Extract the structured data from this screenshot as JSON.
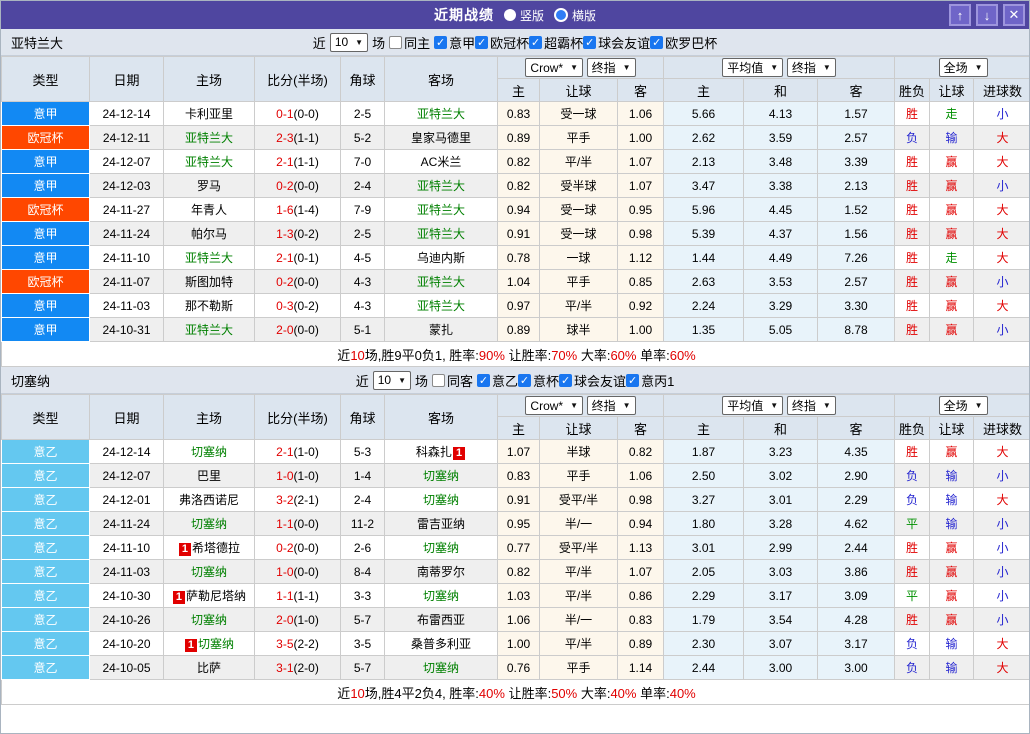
{
  "titlebar": {
    "title": "近期战绩",
    "radio_vertical": "竖版",
    "radio_horizontal": "横版",
    "buttons": {
      "up": "↑",
      "down": "↓",
      "close": "✕"
    }
  },
  "table_header": {
    "type": "类型",
    "date": "日期",
    "home": "主场",
    "score": "比分(半场)",
    "corner": "角球",
    "away": "客场",
    "selects": {
      "source": "Crow*",
      "time1": "终指",
      "avg": "平均值",
      "time2": "终指",
      "scope": "全场"
    },
    "sub": {
      "o_home": "主",
      "o_handicap": "让球",
      "o_away": "客",
      "a_home": "主",
      "a_draw": "和",
      "a_away": "客",
      "result": "胜负",
      "h_result": "让球",
      "goals": "进球数"
    }
  },
  "sections": [
    {
      "team": "亚特兰大",
      "filter": {
        "near_label": "近",
        "games": "10",
        "games_suffix": "场",
        "same_label": "同主",
        "leagues": [
          "意甲",
          "欧冠杯",
          "超霸杯",
          "球会友谊",
          "欧罗巴杯"
        ]
      },
      "rows": [
        {
          "lg": "意甲",
          "lc": "a",
          "date": "24-12-14",
          "home": "卡利亚里",
          "hg": 0,
          "hc": "",
          "score": "0-1",
          "half": "(0-0)",
          "corner": "2-5",
          "away": "亚特兰大",
          "ag": 1,
          "ac": "",
          "o1": "0.83",
          "hd": "受一球",
          "o2": "1.06",
          "a1": "5.66",
          "a2": "4.13",
          "a3": "1.57",
          "res": "胜",
          "resc": "r",
          "hres": "走",
          "hresc": "g",
          "gl": "小",
          "glc": "b"
        },
        {
          "lg": "欧冠杯",
          "lc": "c",
          "date": "24-12-11",
          "home": "亚特兰大",
          "hg": 1,
          "hc": "",
          "score": "2-3",
          "half": "(1-1)",
          "corner": "5-2",
          "away": "皇家马德里",
          "ag": 0,
          "ac": "",
          "o1": "0.89",
          "hd": "平手",
          "o2": "1.00",
          "a1": "2.62",
          "a2": "3.59",
          "a3": "2.57",
          "res": "负",
          "resc": "b",
          "hres": "输",
          "hresc": "b",
          "gl": "大",
          "glc": "r"
        },
        {
          "lg": "意甲",
          "lc": "a",
          "date": "24-12-07",
          "home": "亚特兰大",
          "hg": 1,
          "hc": "",
          "score": "2-1",
          "half": "(1-1)",
          "corner": "7-0",
          "away": "AC米兰",
          "ag": 0,
          "ac": "",
          "o1": "0.82",
          "hd": "平/半",
          "o2": "1.07",
          "a1": "2.13",
          "a2": "3.48",
          "a3": "3.39",
          "res": "胜",
          "resc": "r",
          "hres": "赢",
          "hresc": "r",
          "gl": "大",
          "glc": "r"
        },
        {
          "lg": "意甲",
          "lc": "a",
          "date": "24-12-03",
          "home": "罗马",
          "hg": 0,
          "hc": "",
          "score": "0-2",
          "half": "(0-0)",
          "corner": "2-4",
          "away": "亚特兰大",
          "ag": 1,
          "ac": "",
          "o1": "0.82",
          "hd": "受半球",
          "o2": "1.07",
          "a1": "3.47",
          "a2": "3.38",
          "a3": "2.13",
          "res": "胜",
          "resc": "r",
          "hres": "赢",
          "hresc": "r",
          "gl": "小",
          "glc": "b"
        },
        {
          "lg": "欧冠杯",
          "lc": "c",
          "date": "24-11-27",
          "home": "年青人",
          "hg": 0,
          "hc": "",
          "score": "1-6",
          "half": "(1-4)",
          "corner": "7-9",
          "away": "亚特兰大",
          "ag": 1,
          "ac": "",
          "o1": "0.94",
          "hd": "受一球",
          "o2": "0.95",
          "a1": "5.96",
          "a2": "4.45",
          "a3": "1.52",
          "res": "胜",
          "resc": "r",
          "hres": "赢",
          "hresc": "r",
          "gl": "大",
          "glc": "r"
        },
        {
          "lg": "意甲",
          "lc": "a",
          "date": "24-11-24",
          "home": "帕尔马",
          "hg": 0,
          "hc": "",
          "score": "1-3",
          "half": "(0-2)",
          "corner": "2-5",
          "away": "亚特兰大",
          "ag": 1,
          "ac": "",
          "o1": "0.91",
          "hd": "受一球",
          "o2": "0.98",
          "a1": "5.39",
          "a2": "4.37",
          "a3": "1.56",
          "res": "胜",
          "resc": "r",
          "hres": "赢",
          "hresc": "r",
          "gl": "大",
          "glc": "r"
        },
        {
          "lg": "意甲",
          "lc": "a",
          "date": "24-11-10",
          "home": "亚特兰大",
          "hg": 1,
          "hc": "",
          "score": "2-1",
          "half": "(0-1)",
          "corner": "4-5",
          "away": "乌迪内斯",
          "ag": 0,
          "ac": "",
          "o1": "0.78",
          "hd": "一球",
          "o2": "1.12",
          "a1": "1.44",
          "a2": "4.49",
          "a3": "7.26",
          "res": "胜",
          "resc": "r",
          "hres": "走",
          "hresc": "g",
          "gl": "大",
          "glc": "r"
        },
        {
          "lg": "欧冠杯",
          "lc": "c",
          "date": "24-11-07",
          "home": "斯图加特",
          "hg": 0,
          "hc": "",
          "score": "0-2",
          "half": "(0-0)",
          "corner": "4-3",
          "away": "亚特兰大",
          "ag": 1,
          "ac": "",
          "o1": "1.04",
          "hd": "平手",
          "o2": "0.85",
          "a1": "2.63",
          "a2": "3.53",
          "a3": "2.57",
          "res": "胜",
          "resc": "r",
          "hres": "赢",
          "hresc": "r",
          "gl": "小",
          "glc": "b"
        },
        {
          "lg": "意甲",
          "lc": "a",
          "date": "24-11-03",
          "home": "那不勒斯",
          "hg": 0,
          "hc": "",
          "score": "0-3",
          "half": "(0-2)",
          "corner": "4-3",
          "away": "亚特兰大",
          "ag": 1,
          "ac": "",
          "o1": "0.97",
          "hd": "平/半",
          "o2": "0.92",
          "a1": "2.24",
          "a2": "3.29",
          "a3": "3.30",
          "res": "胜",
          "resc": "r",
          "hres": "赢",
          "hresc": "r",
          "gl": "大",
          "glc": "r"
        },
        {
          "lg": "意甲",
          "lc": "a",
          "date": "24-10-31",
          "home": "亚特兰大",
          "hg": 1,
          "hc": "",
          "score": "2-0",
          "half": "(0-0)",
          "corner": "5-1",
          "away": "蒙扎",
          "ag": 0,
          "ac": "",
          "o1": "0.89",
          "hd": "球半",
          "o2": "1.00",
          "a1": "1.35",
          "a2": "5.05",
          "a3": "8.78",
          "res": "胜",
          "resc": "r",
          "hres": "赢",
          "hresc": "r",
          "gl": "小",
          "glc": "b"
        }
      ],
      "summary": [
        {
          "t": "近"
        },
        {
          "t": "10",
          "red": 1
        },
        {
          "t": "场,胜9平0负1, 胜率:"
        },
        {
          "t": "90%",
          "red": 1
        },
        {
          "t": " 让胜率:"
        },
        {
          "t": "70%",
          "red": 1
        },
        {
          "t": " 大率:"
        },
        {
          "t": "60%",
          "red": 1
        },
        {
          "t": " 单率:"
        },
        {
          "t": "60%",
          "red": 1
        }
      ]
    },
    {
      "team": "切塞纳",
      "filter": {
        "near_label": "近",
        "games": "10",
        "games_suffix": "场",
        "same_label": "同客",
        "leagues": [
          "意乙",
          "意杯",
          "球会友谊",
          "意丙1"
        ]
      },
      "rows": [
        {
          "lg": "意乙",
          "lc": "b",
          "date": "24-12-14",
          "home": "切塞纳",
          "hg": 1,
          "hc": "",
          "score": "2-1",
          "half": "(1-0)",
          "corner": "5-3",
          "away": "科森扎",
          "ag": 0,
          "ac": "1",
          "o1": "1.07",
          "hd": "半球",
          "o2": "0.82",
          "a1": "1.87",
          "a2": "3.23",
          "a3": "4.35",
          "res": "胜",
          "resc": "r",
          "hres": "赢",
          "hresc": "r",
          "gl": "大",
          "glc": "r"
        },
        {
          "lg": "意乙",
          "lc": "b",
          "date": "24-12-07",
          "home": "巴里",
          "hg": 0,
          "hc": "",
          "score": "1-0",
          "half": "(1-0)",
          "corner": "1-4",
          "away": "切塞纳",
          "ag": 1,
          "ac": "",
          "o1": "0.83",
          "hd": "平手",
          "o2": "1.06",
          "a1": "2.50",
          "a2": "3.02",
          "a3": "2.90",
          "res": "负",
          "resc": "b",
          "hres": "输",
          "hresc": "b",
          "gl": "小",
          "glc": "b"
        },
        {
          "lg": "意乙",
          "lc": "b",
          "date": "24-12-01",
          "home": "弗洛西诺尼",
          "hg": 0,
          "hc": "",
          "score": "3-2",
          "half": "(2-1)",
          "corner": "2-4",
          "away": "切塞纳",
          "ag": 1,
          "ac": "",
          "o1": "0.91",
          "hd": "受平/半",
          "o2": "0.98",
          "a1": "3.27",
          "a2": "3.01",
          "a3": "2.29",
          "res": "负",
          "resc": "b",
          "hres": "输",
          "hresc": "b",
          "gl": "大",
          "glc": "r"
        },
        {
          "lg": "意乙",
          "lc": "b",
          "date": "24-11-24",
          "home": "切塞纳",
          "hg": 1,
          "hc": "",
          "score": "1-1",
          "half": "(0-0)",
          "corner": "11-2",
          "away": "雷吉亚纳",
          "ag": 0,
          "ac": "",
          "o1": "0.95",
          "hd": "半/一",
          "o2": "0.94",
          "a1": "1.80",
          "a2": "3.28",
          "a3": "4.62",
          "res": "平",
          "resc": "g",
          "hres": "输",
          "hresc": "b",
          "gl": "小",
          "glc": "b"
        },
        {
          "lg": "意乙",
          "lc": "b",
          "date": "24-11-10",
          "home": "希塔德拉",
          "hg": 0,
          "hc": "1",
          "score": "0-2",
          "half": "(0-0)",
          "corner": "2-6",
          "away": "切塞纳",
          "ag": 1,
          "ac": "",
          "o1": "0.77",
          "hd": "受平/半",
          "o2": "1.13",
          "a1": "3.01",
          "a2": "2.99",
          "a3": "2.44",
          "res": "胜",
          "resc": "r",
          "hres": "赢",
          "hresc": "r",
          "gl": "小",
          "glc": "b"
        },
        {
          "lg": "意乙",
          "lc": "b",
          "date": "24-11-03",
          "home": "切塞纳",
          "hg": 1,
          "hc": "",
          "score": "1-0",
          "half": "(0-0)",
          "corner": "8-4",
          "away": "南蒂罗尔",
          "ag": 0,
          "ac": "",
          "o1": "0.82",
          "hd": "平/半",
          "o2": "1.07",
          "a1": "2.05",
          "a2": "3.03",
          "a3": "3.86",
          "res": "胜",
          "resc": "r",
          "hres": "赢",
          "hresc": "r",
          "gl": "小",
          "glc": "b"
        },
        {
          "lg": "意乙",
          "lc": "b",
          "date": "24-10-30",
          "home": "萨勒尼塔纳",
          "hg": 0,
          "hc": "1",
          "score": "1-1",
          "half": "(1-1)",
          "corner": "3-3",
          "away": "切塞纳",
          "ag": 1,
          "ac": "",
          "o1": "1.03",
          "hd": "平/半",
          "o2": "0.86",
          "a1": "2.29",
          "a2": "3.17",
          "a3": "3.09",
          "res": "平",
          "resc": "g",
          "hres": "赢",
          "hresc": "r",
          "gl": "小",
          "glc": "b"
        },
        {
          "lg": "意乙",
          "lc": "b",
          "date": "24-10-26",
          "home": "切塞纳",
          "hg": 1,
          "hc": "",
          "score": "2-0",
          "half": "(1-0)",
          "corner": "5-7",
          "away": "布雷西亚",
          "ag": 0,
          "ac": "",
          "o1": "1.06",
          "hd": "半/一",
          "o2": "0.83",
          "a1": "1.79",
          "a2": "3.54",
          "a3": "4.28",
          "res": "胜",
          "resc": "r",
          "hres": "赢",
          "hresc": "r",
          "gl": "小",
          "glc": "b"
        },
        {
          "lg": "意乙",
          "lc": "b",
          "date": "24-10-20",
          "home": "切塞纳",
          "hg": 1,
          "hc": "1",
          "score": "3-5",
          "half": "(2-2)",
          "corner": "3-5",
          "away": "桑普多利亚",
          "ag": 0,
          "ac": "",
          "o1": "1.00",
          "hd": "平/半",
          "o2": "0.89",
          "a1": "2.30",
          "a2": "3.07",
          "a3": "3.17",
          "res": "负",
          "resc": "b",
          "hres": "输",
          "hresc": "b",
          "gl": "大",
          "glc": "r"
        },
        {
          "lg": "意乙",
          "lc": "b",
          "date": "24-10-05",
          "home": "比萨",
          "hg": 0,
          "hc": "",
          "score": "3-1",
          "half": "(2-0)",
          "corner": "5-7",
          "away": "切塞纳",
          "ag": 1,
          "ac": "",
          "o1": "0.76",
          "hd": "平手",
          "o2": "1.14",
          "a1": "2.44",
          "a2": "3.00",
          "a3": "3.00",
          "res": "负",
          "resc": "b",
          "hres": "输",
          "hresc": "b",
          "gl": "大",
          "glc": "r"
        }
      ],
      "summary": [
        {
          "t": "近"
        },
        {
          "t": "10",
          "red": 1
        },
        {
          "t": "场,胜4平2负4, 胜率:"
        },
        {
          "t": "40%",
          "red": 1
        },
        {
          "t": " 让胜率:"
        },
        {
          "t": "50%",
          "red": 1
        },
        {
          "t": " 大率:"
        },
        {
          "t": "40%",
          "red": 1
        },
        {
          "t": " 单率:"
        },
        {
          "t": "40%",
          "red": 1
        }
      ]
    }
  ]
}
